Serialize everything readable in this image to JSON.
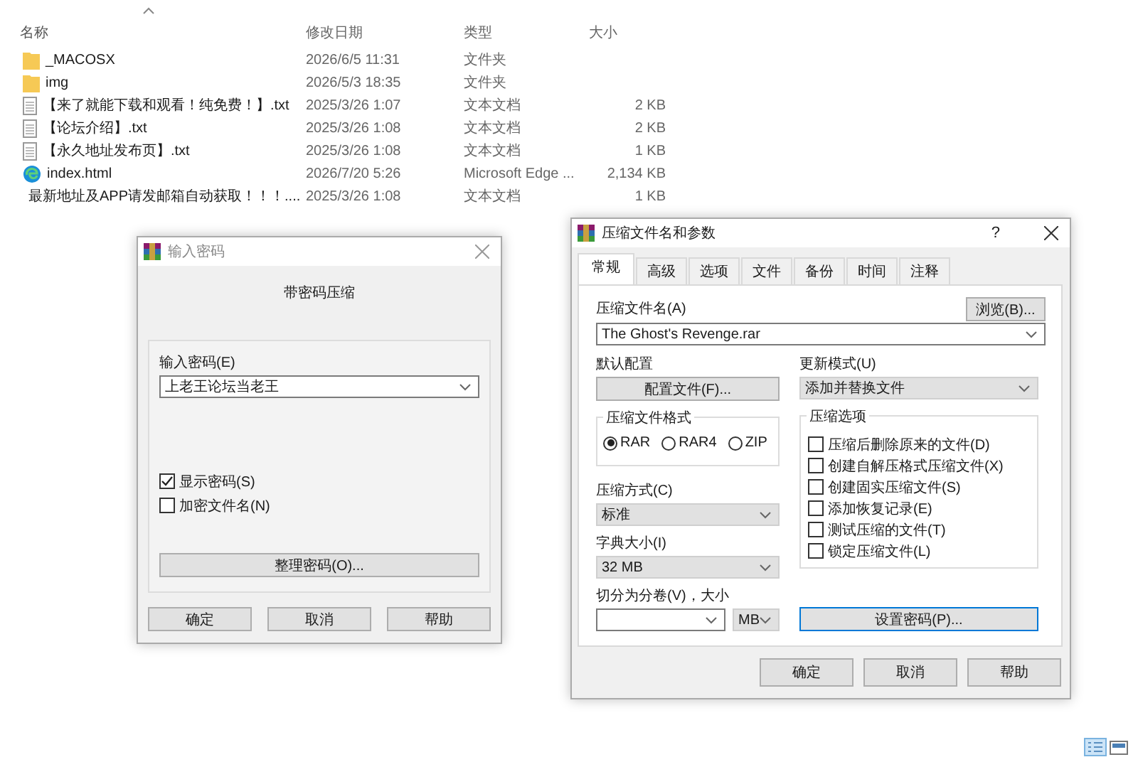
{
  "explorer": {
    "columns": [
      {
        "label": "名称",
        "sorted": true
      },
      {
        "label": "修改日期",
        "sorted": false
      },
      {
        "label": "类型",
        "sorted": false
      },
      {
        "label": "大小",
        "sorted": false
      }
    ],
    "rows": [
      {
        "kind": "folder",
        "name": "_MACOSX",
        "modified": "2026/6/5 11:31",
        "type": "文件夹"
      },
      {
        "kind": "folder",
        "name": "img",
        "modified": "2026/5/3 18:35",
        "type": "文件夹"
      },
      {
        "kind": "text",
        "name": "【来了就能下载和观看！纯免费！】.txt",
        "modified": "2025/3/26 1:07",
        "type": "文本文档",
        "size": "2 KB"
      },
      {
        "kind": "text",
        "name": "【论坛介绍】.txt",
        "modified": "2025/3/26 1:08",
        "type": "文本文档",
        "size": "2 KB"
      },
      {
        "kind": "text",
        "name": "【永久地址发布页】.txt",
        "modified": "2025/3/26 1:08",
        "type": "文本文档",
        "size": "1 KB"
      },
      {
        "kind": "web",
        "name": "index.html",
        "modified": "2026/7/20 5:26",
        "type": "Microsoft Edge ...",
        "size": "2,134 KB"
      },
      {
        "kind": "text",
        "name": "最新地址及APP请发邮箱自动获取！！！....",
        "modified": "2025/3/26 1:08",
        "type": "文本文档",
        "size": "1 KB"
      }
    ]
  },
  "password_dialog": {
    "title": "输入密码",
    "heading": "带密码压缩",
    "password_label": "输入密码(E)",
    "password": "上老王论坛当老王",
    "checkboxes": [
      {
        "label": "显示密码(S)",
        "checked": true
      },
      {
        "label": "加密文件名(N)",
        "checked": false
      }
    ],
    "organize_button": "整理密码(O)...",
    "buttons": [
      "确定",
      "取消",
      "帮助"
    ]
  },
  "archive_dialog": {
    "title": "压缩文件名和参数",
    "help": "?",
    "tabs": [
      {
        "label": "常规",
        "selected": true
      },
      {
        "label": "高级",
        "selected": false
      },
      {
        "label": "选项",
        "selected": false
      },
      {
        "label": "文件",
        "selected": false
      },
      {
        "label": "备份",
        "selected": false
      },
      {
        "label": "时间",
        "selected": false
      },
      {
        "label": "注释",
        "selected": false
      }
    ],
    "archive_name_label": "压缩文件名(A)",
    "browse_button": "浏览(B)...",
    "archive_name": "The Ghost's Revenge.rar",
    "profile_label": "默认配置",
    "profile_button": "配置文件(F)...",
    "update_mode_label": "更新模式(U)",
    "update_mode": "添加并替换文件",
    "format_group": {
      "label": "压缩文件格式",
      "options": [
        {
          "label": "RAR",
          "selected": true
        },
        {
          "label": "RAR4",
          "selected": false
        },
        {
          "label": "ZIP",
          "selected": false
        }
      ]
    },
    "options_group": {
      "label": "压缩选项",
      "options": [
        {
          "label": "压缩后删除原来的文件(D)",
          "checked": false
        },
        {
          "label": "创建自解压格式压缩文件(X)",
          "checked": false
        },
        {
          "label": "创建固实压缩文件(S)",
          "checked": false
        },
        {
          "label": "添加恢复记录(E)",
          "checked": false
        },
        {
          "label": "测试压缩的文件(T)",
          "checked": false
        },
        {
          "label": "锁定压缩文件(L)",
          "checked": false
        }
      ]
    },
    "method_label": "压缩方式(C)",
    "method": "标准",
    "dict_label": "字典大小(I)",
    "dict": "32 MB",
    "split_label": "切分为分卷(V)，大小",
    "split_unit": "MB",
    "password_button": {
      "label": "设置密码(P)...",
      "focused": true
    },
    "buttons": [
      "确定",
      "取消",
      "帮助"
    ]
  }
}
